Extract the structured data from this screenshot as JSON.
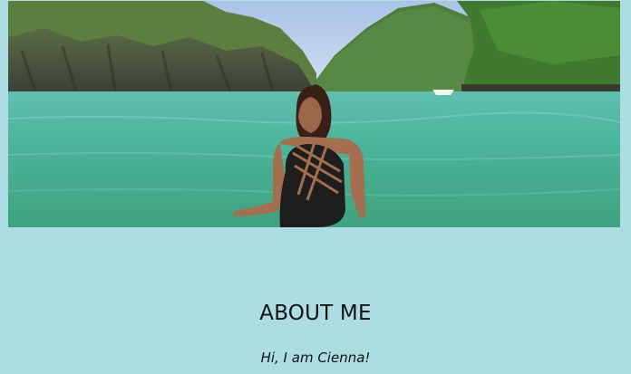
{
  "hero": {
    "image_subject": "woman-standing-in-lagoon-photo"
  },
  "about": {
    "title": "ABOUT ME",
    "intro": "Hi, I am Cienna!"
  },
  "colors": {
    "page_background": "#acdde3",
    "text": "#111111"
  }
}
